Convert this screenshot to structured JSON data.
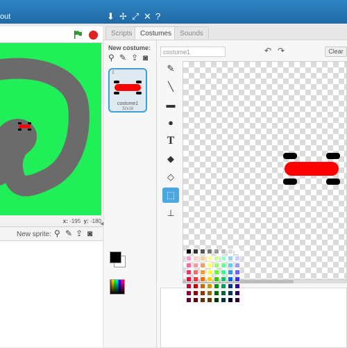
{
  "menubar": {
    "about_label": "out",
    "icons": [
      "duplicate-icon",
      "move-icon",
      "grow-icon",
      "shrink-icon",
      "help-icon"
    ]
  },
  "stage": {
    "green_flag": "green-flag-icon",
    "stop": "stop-icon",
    "coords_x_label": "x:",
    "coords_x_value": "-195",
    "coords_y_label": "y:",
    "coords_y_value": "-180"
  },
  "sprites": {
    "new_sprite_label": "New sprite:"
  },
  "tabs": [
    {
      "label": "Scripts"
    },
    {
      "label": "Costumes"
    },
    {
      "label": "Sounds"
    }
  ],
  "costumes": {
    "new_costume_label": "New costume:",
    "items": [
      {
        "number": "1",
        "name": "costume1",
        "size": "32x16"
      }
    ]
  },
  "editor": {
    "costume_name": "costume1",
    "clear_label": "Clear",
    "tools": [
      {
        "name": "brush-tool",
        "glyph": "✎"
      },
      {
        "name": "line-tool",
        "glyph": "╲"
      },
      {
        "name": "rectangle-tool",
        "glyph": "▬"
      },
      {
        "name": "ellipse-tool",
        "glyph": "●"
      },
      {
        "name": "text-tool",
        "glyph": "T"
      },
      {
        "name": "fill-tool",
        "glyph": "◆"
      },
      {
        "name": "eraser-tool",
        "glyph": "◇"
      },
      {
        "name": "select-tool",
        "glyph": "⬚"
      },
      {
        "name": "stamp-tool",
        "glyph": "⊥"
      }
    ]
  },
  "colors": {
    "menubar": "#2579b8",
    "stage_bg": "#21ef58",
    "track": "#6b6b6b",
    "car_body": "#ff0000",
    "tire": "#000000",
    "primary": "#000000",
    "secondary": "#ffffff",
    "selected_tool": "#4aa7df"
  }
}
